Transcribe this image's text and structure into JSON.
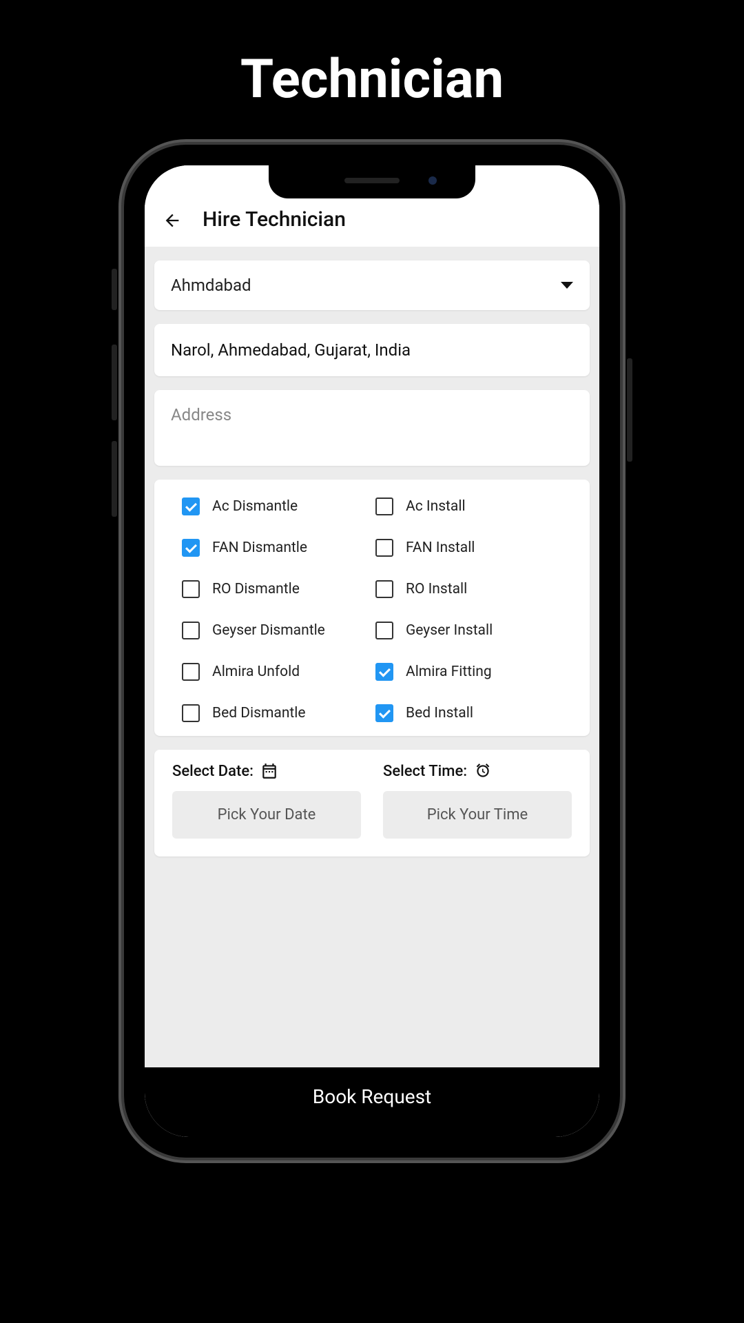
{
  "pageTitle": "Technician",
  "header": {
    "title": "Hire Technician"
  },
  "citySelect": {
    "selected": "Ahmdabad"
  },
  "location": "Narol, Ahmedabad, Gujarat, India",
  "addressField": {
    "placeholder": "Address",
    "value": ""
  },
  "services": [
    {
      "id": "ac-dismantle",
      "label": "Ac Dismantle",
      "checked": true
    },
    {
      "id": "ac-install",
      "label": "Ac Install",
      "checked": false
    },
    {
      "id": "fan-dismantle",
      "label": "FAN Dismantle",
      "checked": true
    },
    {
      "id": "fan-install",
      "label": "FAN Install",
      "checked": false
    },
    {
      "id": "ro-dismantle",
      "label": "RO Dismantle",
      "checked": false
    },
    {
      "id": "ro-install",
      "label": "RO Install",
      "checked": false
    },
    {
      "id": "geyser-dismantle",
      "label": "Geyser Dismantle",
      "checked": false
    },
    {
      "id": "geyser-install",
      "label": "Geyser Install",
      "checked": false
    },
    {
      "id": "almira-unfold",
      "label": "Almira Unfold",
      "checked": false
    },
    {
      "id": "almira-fitting",
      "label": "Almira Fitting",
      "checked": true
    },
    {
      "id": "bed-dismantle",
      "label": "Bed Dismantle",
      "checked": false
    },
    {
      "id": "bed-install",
      "label": "Bed Install",
      "checked": true
    }
  ],
  "date": {
    "label": "Select Date:",
    "buttonLabel": "Pick Your Date"
  },
  "time": {
    "label": "Select Time:",
    "buttonLabel": "Pick Your Time"
  },
  "bookButton": "Book Request",
  "colors": {
    "accent": "#2196f3",
    "background": "#ececec"
  }
}
